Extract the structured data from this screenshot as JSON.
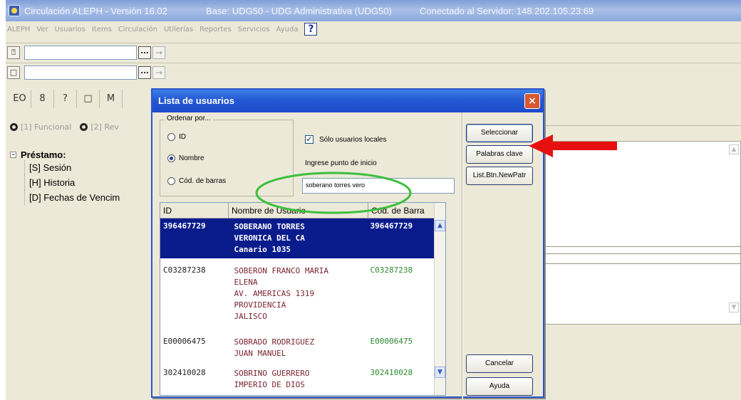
{
  "window": {
    "title": "Circulación ALEPH - Versión 16.02",
    "base": "Base:  UDG50 - UDG Administrativa (UDG50)",
    "connection": "Conectado al Servidor:  148.202.105.23:69"
  },
  "menu": {
    "items": [
      "ALEPH",
      "Ver",
      "Usuarios",
      "Items",
      "Circulación",
      "Utilerías",
      "Reportes",
      "Servicios",
      "Ayuda"
    ],
    "help_icon": "?"
  },
  "toolbar": {
    "row1_icon": "question-badge-icon",
    "row2_icon": "copy-icon",
    "dots": "...",
    "arrow": "→"
  },
  "tabs": [
    {
      "icon": "EO"
    },
    {
      "icon": "8"
    },
    {
      "icon": "?"
    },
    {
      "icon": "□"
    },
    {
      "icon": "M"
    }
  ],
  "view_options": {
    "opt1": "[1] Funcional",
    "opt2": "[2] Rev"
  },
  "tree": {
    "root": "Préstamo:",
    "children": [
      "[S] Sesión",
      "[H] Historia",
      "[D] Fechas de Vencim"
    ]
  },
  "dialog": {
    "title": "Lista de usuarios",
    "close": "×",
    "sort_group": "Ordenar por...",
    "sort_options": [
      "ID",
      "Nombre",
      "Cód. de barras"
    ],
    "sort_selected": "Nombre",
    "local_only_label": "Sólo usuarios locales",
    "local_only_checked": true,
    "start_label": "Ingrese punto de inicio",
    "start_value": "soberano torres vero",
    "columns": [
      "ID",
      "Nombre de Usuario",
      "Cód. de Barra"
    ],
    "rows": [
      {
        "id": "396467729",
        "name": "SOBERANO TORRES\nVERONICA DEL CA\nCanario 1035",
        "barcode": "396467729"
      },
      {
        "id": "C03287238",
        "name": "SOBERON FRANCO MARIA\nELENA\nAV. AMERICAS 1319\nPROVIDENCIA\nJALISCO",
        "barcode": "C03287238"
      },
      {
        "id": "E00006475",
        "name": "SOBRADO RODRIGUEZ\nJUAN MANUEL",
        "barcode": "E00006475"
      },
      {
        "id": "302410028",
        "name": "SOBRINO GUERRERO\nIMPERIO DE DIOS",
        "barcode": "302410028"
      }
    ],
    "buttons": {
      "select": "Seleccionar",
      "keywords": "Palabras clave",
      "list_btn": "List.Btn.NewPatr",
      "cancel": "Cancelar",
      "help": "Ayuda"
    }
  },
  "colors": {
    "selected_row": "#0a1c8c",
    "annotation_arrow": "#e61010",
    "annotation_ellipse": "#3cbf3c"
  }
}
